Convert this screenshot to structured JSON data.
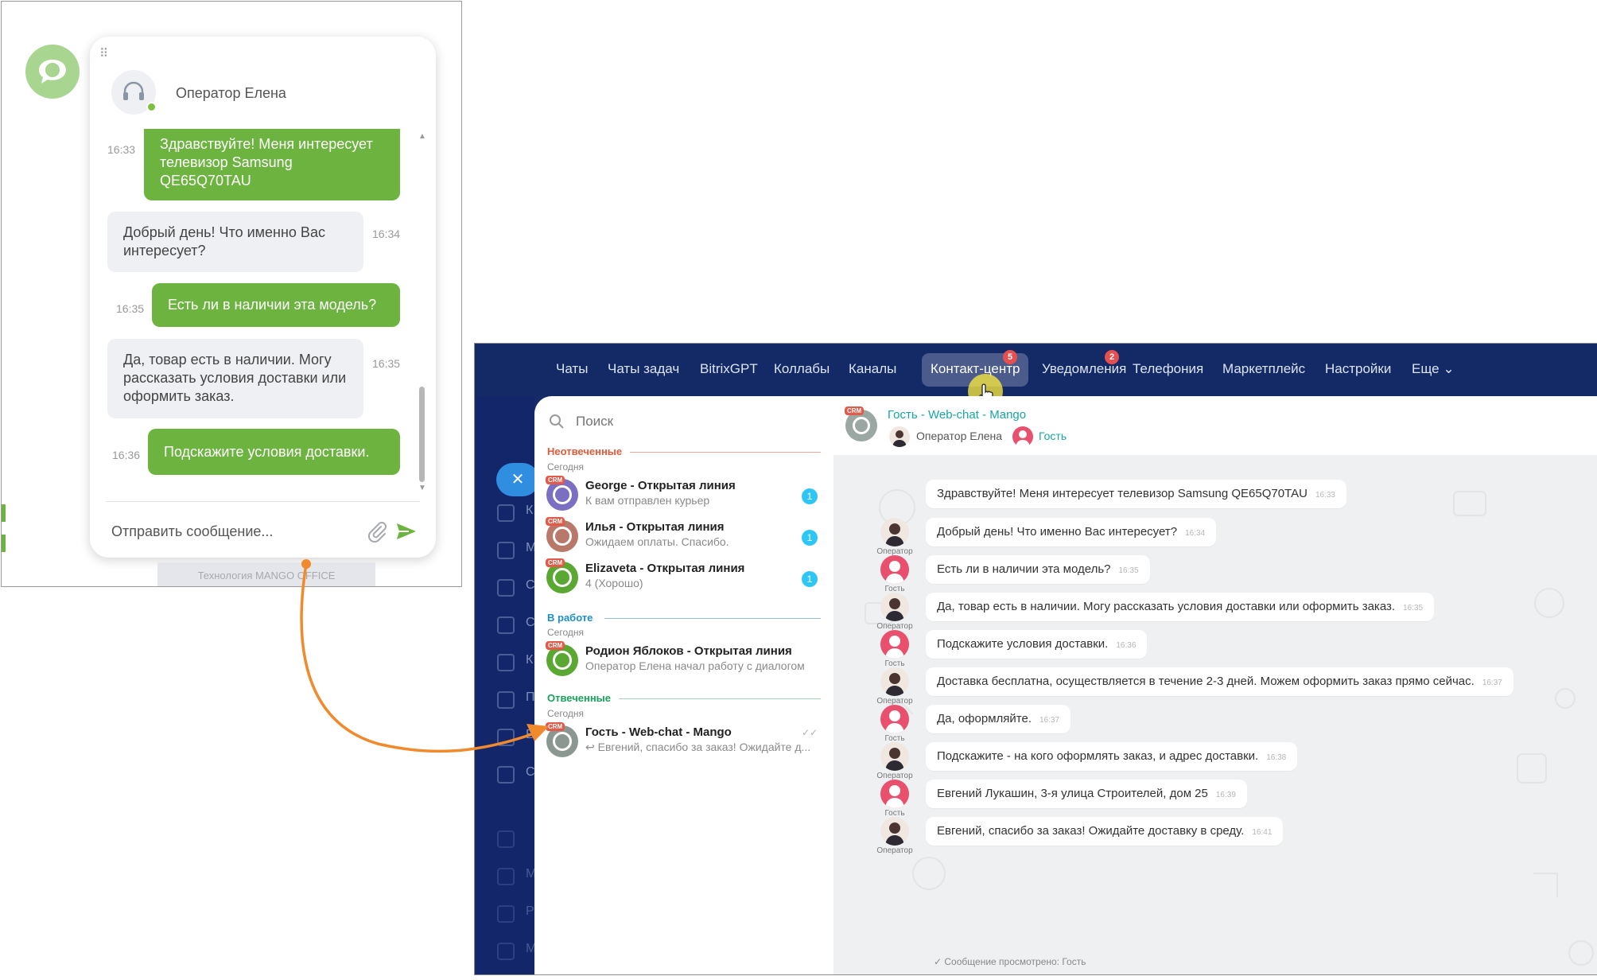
{
  "widget": {
    "operator_name": "Оператор Елена",
    "messages": [
      {
        "side": "out",
        "text": "Здравствуйте! Меня интересует телевизор Samsung QE65Q70TAU",
        "time": "16:33"
      },
      {
        "side": "in",
        "text": "Добрый день! Что именно Вас интересует?",
        "time": "16:34"
      },
      {
        "side": "out",
        "text": "Есть ли в наличии эта модель?",
        "time": "16:35"
      },
      {
        "side": "in",
        "text": "Да, товар есть в наличии. Могу рассказать условия доставки или оформить заказ.",
        "time": "16:35"
      },
      {
        "side": "out",
        "text": "Подскажите условия доставки.",
        "time": "16:36"
      }
    ],
    "input_placeholder": "Отправить сообщение...",
    "footer": "Технология MANGO OFFICE",
    "colors": {
      "accent": "#6db33f",
      "incoming_bg": "#eef0f3"
    }
  },
  "bitrix": {
    "nav": [
      {
        "label": "Чаты"
      },
      {
        "label": "Чаты задач"
      },
      {
        "label": "BitrixGPT"
      },
      {
        "label": "Коллабы"
      },
      {
        "label": "Каналы"
      },
      {
        "label": "Контакт-центр",
        "badge": "5",
        "active": true
      },
      {
        "label": "Уведомления",
        "badge": "2"
      },
      {
        "label": "Телефония"
      },
      {
        "label": "Маркетплейс"
      },
      {
        "label": "Настройки"
      },
      {
        "label": "Еще ⌄"
      }
    ],
    "sidebar_letters": [
      "К",
      "М",
      "С",
      "С",
      "К",
      "П",
      "В",
      "С",
      "М",
      "Р",
      "М",
      "М"
    ],
    "search_placeholder": "Поиск",
    "crm_tag": "CRM",
    "sections": [
      {
        "title": "Неотвеченные",
        "date": "Сегодня",
        "color": "#e25a3a",
        "chats": [
          {
            "name": "George - Открытая линия",
            "sub": "К вам отправлен курьер",
            "count": "1",
            "color": "#7b6fc2"
          },
          {
            "name": "Илья - Открытая линия",
            "sub": "Ожидаем оплаты. Спасибо.",
            "count": "1",
            "color": "#b8786a"
          },
          {
            "name": "Elizaveta - Открытая линия",
            "sub": "4 (Хорошо)",
            "count": "1",
            "color": "#5aa832"
          }
        ]
      },
      {
        "title": "В работе",
        "date": "Сегодня",
        "color": "#1c8fc6",
        "chats": [
          {
            "name": "Родион Яблоков - Открытая линия",
            "sub": "Оператор Елена начал работу с диалогом",
            "count": "",
            "color": "#5aa832"
          }
        ]
      },
      {
        "title": "Отвеченные",
        "date": "Сегодня",
        "color": "#17a35a",
        "chats": [
          {
            "name": "Гость - Web-chat - Mango",
            "sub": "↩ Евгений, спасибо за заказ! Ожидайте д...",
            "count": "",
            "color": "#8b9892",
            "check": "✓✓"
          }
        ]
      }
    ],
    "chat_header": {
      "title": "Гость - Web-chat - Mango",
      "operator": "Оператор Елена",
      "guest": "Гость"
    },
    "labels": {
      "operator": "Оператор",
      "guest": "Гость"
    },
    "messages": [
      {
        "from": "guest",
        "text": "Здравствуйте! Меня интересует телевизор Samsung QE65Q70TAU",
        "time": "16:33",
        "show_avatar": false
      },
      {
        "from": "operator",
        "text": "Добрый день! Что именно Вас интересует?",
        "time": "16:34",
        "show_avatar": true
      },
      {
        "from": "guest",
        "text": "Есть ли в наличии эта модель?",
        "time": "16:35",
        "show_avatar": true
      },
      {
        "from": "operator",
        "text": "Да, товар есть в наличии. Могу рассказать условия доставки или оформить заказ.",
        "time": "16:35",
        "show_avatar": true
      },
      {
        "from": "guest",
        "text": "Подскажите условия доставки.",
        "time": "16:36",
        "show_avatar": true
      },
      {
        "from": "operator",
        "text": "Доставка бесплатна, осуществляется в течение 2-3 дней. Можем оформить заказ прямо сейчас.",
        "time": "16:37",
        "show_avatar": true
      },
      {
        "from": "guest",
        "text": "Да, оформляйте.",
        "time": "16:37",
        "show_avatar": true
      },
      {
        "from": "operator",
        "text": "Подскажите - на кого оформлять заказ, и адрес доставки.",
        "time": "16:38",
        "show_avatar": true
      },
      {
        "from": "guest",
        "text": "Евгений Лукашин, 3-я улица Строителей, дом 25",
        "time": "16:39",
        "show_avatar": true
      },
      {
        "from": "operator",
        "text": "Евгений, спасибо за заказ! Ожидайте доставку в среду.",
        "time": "16:41",
        "show_avatar": true
      }
    ],
    "seen_status": "Сообщение просмотрено: Гость",
    "colors": {
      "nav_bg": "#142a66",
      "accent_teal": "#17a6a5",
      "badge_red": "#e64f4f",
      "unread_blue": "#2fc6f6"
    }
  }
}
